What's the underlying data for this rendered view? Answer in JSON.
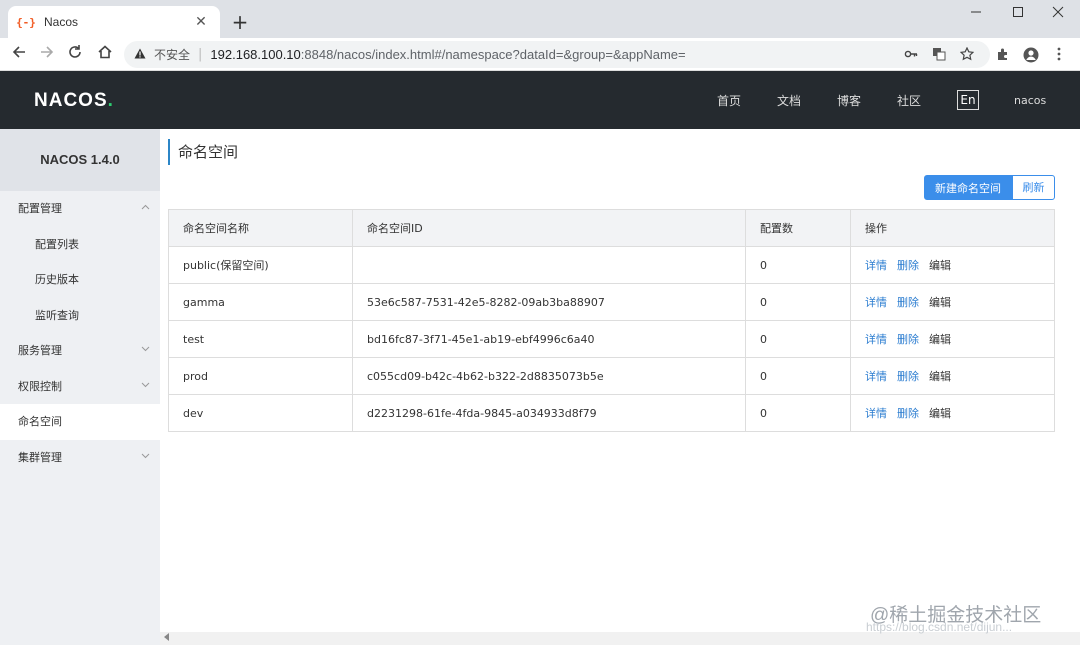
{
  "browser": {
    "tab_title": "Nacos",
    "tab_favicon": "{-}",
    "close_glyph": "✕",
    "new_tab_glyph": "+",
    "insecure_label": "不安全",
    "url_host": "192.168.100.10",
    "url_path": ":8848/nacos/index.html#/namespace?dataId=&group=&appName="
  },
  "header": {
    "logo": "NACOS",
    "logo_dot": ".",
    "nav": [
      "首页",
      "文档",
      "博客",
      "社区"
    ],
    "lang": "En",
    "user": "nacos"
  },
  "sidebar": {
    "version": "NACOS 1.4.0",
    "items": [
      {
        "label": "配置管理"
      },
      {
        "label": "配置列表"
      },
      {
        "label": "历史版本"
      },
      {
        "label": "监听查询"
      },
      {
        "label": "服务管理"
      },
      {
        "label": "权限控制"
      },
      {
        "label": "命名空间"
      },
      {
        "label": "集群管理"
      }
    ]
  },
  "main": {
    "title": "命名空间",
    "new_button": "新建命名空间",
    "refresh_button": "刷新",
    "table": {
      "headers": [
        "命名空间名称",
        "命名空间ID",
        "配置数",
        "操作"
      ],
      "actions": {
        "detail": "详情",
        "delete": "删除",
        "edit": "编辑"
      },
      "rows": [
        {
          "name": "public(保留空间)",
          "id": "",
          "count": "0"
        },
        {
          "name": "gamma",
          "id": "53e6c587-7531-42e5-8282-09ab3ba88907",
          "count": "0"
        },
        {
          "name": "test",
          "id": "bd16fc87-3f71-45e1-ab19-ebf4996c6a40",
          "count": "0"
        },
        {
          "name": "prod",
          "id": "c055cd09-b42c-4b62-b322-2d8835073b5e",
          "count": "0"
        },
        {
          "name": "dev",
          "id": "d2231298-61fe-4fda-9845-a034933d8f79",
          "count": "0"
        }
      ]
    }
  },
  "watermark": "@稀土掘金技术社区",
  "watermark_url": "https://blog.csdn.net/dijun..."
}
